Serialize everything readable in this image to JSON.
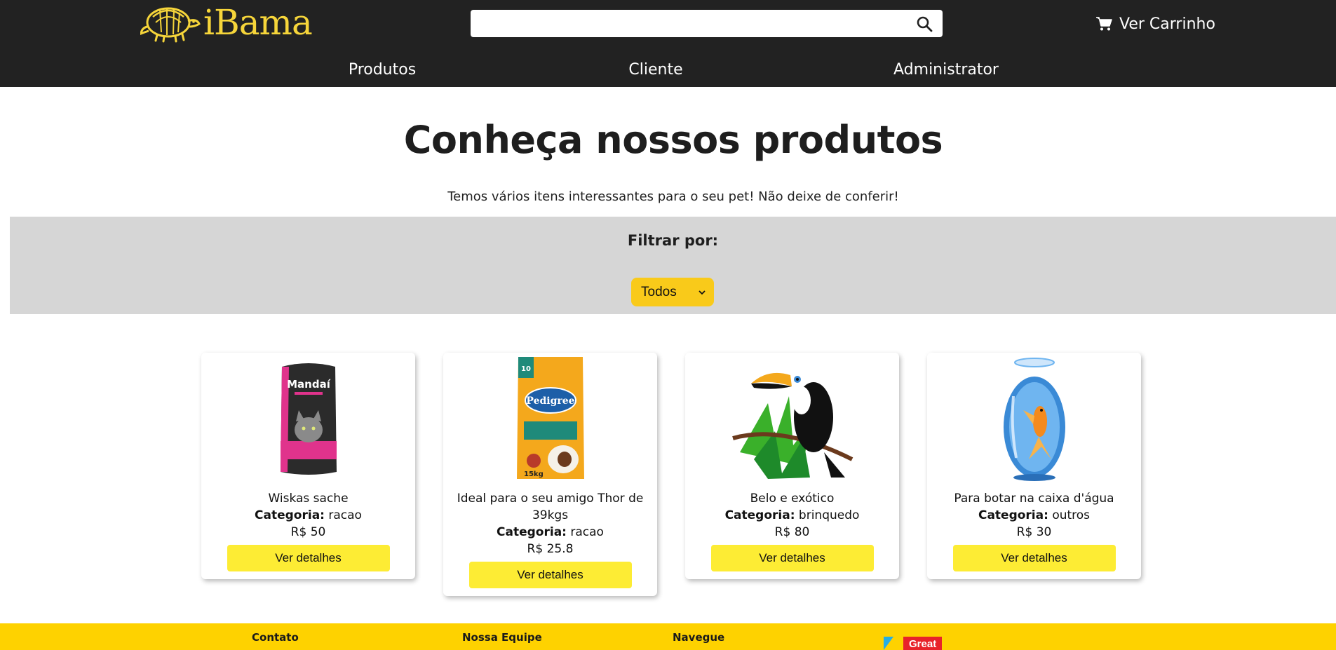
{
  "header": {
    "logo_text": "iBama",
    "search_placeholder": "",
    "cart_label": "Ver Carrinho",
    "nav": [
      "Produtos",
      "Cliente",
      "Administrator"
    ]
  },
  "hero": {
    "title": "Conheça nossos produtos",
    "subtitle": "Temos vários itens interessantes para o seu pet! Não deixe de conferir!"
  },
  "filter": {
    "label": "Filtrar por:",
    "selected": "Todos"
  },
  "products": [
    {
      "name": "Wiskas sache",
      "category_label": "Categoria:",
      "category": "racao",
      "price": "R$ 50",
      "button": "Ver detalhes",
      "image": "cat-food-bag"
    },
    {
      "name": "Ideal para o seu amigo Thor de 39kgs",
      "category_label": "Categoria:",
      "category": "racao",
      "price": "R$ 25.8",
      "button": "Ver detalhes",
      "image": "dog-food-bag"
    },
    {
      "name": "Belo e exótico",
      "category_label": "Categoria:",
      "category": "brinquedo",
      "price": "R$ 80",
      "button": "Ver detalhes",
      "image": "toucan"
    },
    {
      "name": "Para botar na caixa d'água",
      "category_label": "Categoria:",
      "category": "outros",
      "price": "R$ 30",
      "button": "Ver detalhes",
      "image": "goldfish-bowl"
    }
  ],
  "footer": {
    "headings": [
      "Contato",
      "Nossa Equipe",
      "Navegue"
    ],
    "badge_text": "Great"
  },
  "colors": {
    "header_bg": "#222222",
    "logo": "#f6d53a",
    "filter_bg": "#d6d6d6",
    "select_bg": "#f9ca1a",
    "button_bg": "#fdec34",
    "footer_bg": "#fed200"
  }
}
